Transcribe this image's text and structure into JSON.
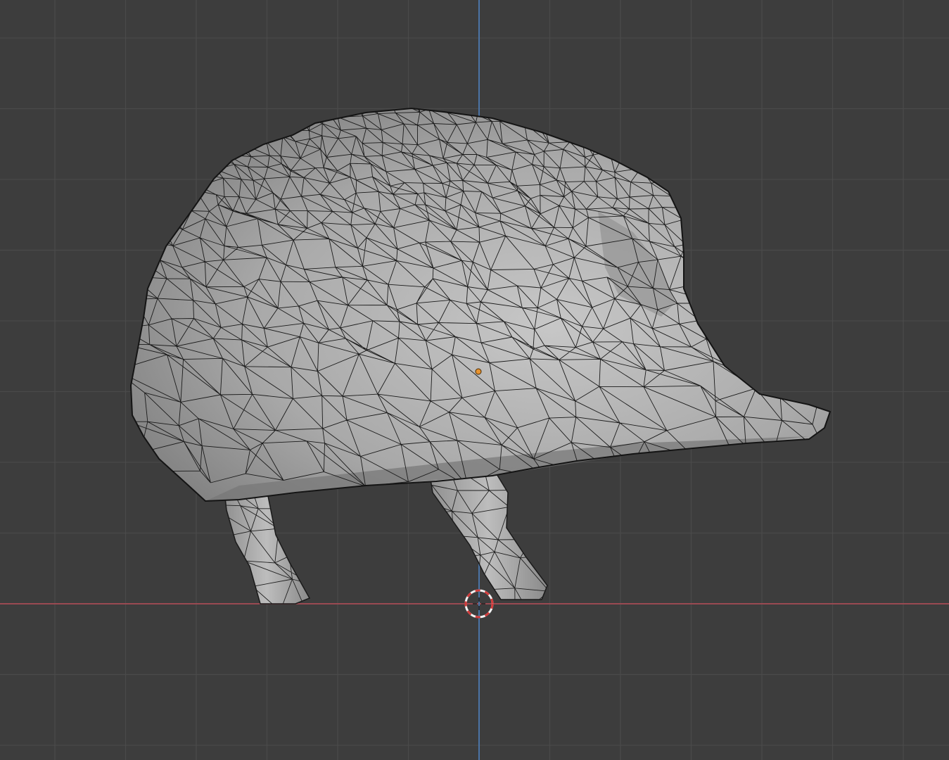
{
  "viewport": {
    "background": "#3d3d3d",
    "view": "front-orthographic",
    "grid_color": "#4a4a4a",
    "x_axis_color": "#9a4a52",
    "z_axis_color": "#4b74a6",
    "mesh": {
      "object": "hedgehog",
      "shading": "solid",
      "overlay": "wireframe",
      "surface_color": "#a9a9a9",
      "wire_color": "#1a1a1a",
      "origin_color": "#e8932f"
    },
    "cursor": {
      "icon": "3d-cursor-icon",
      "colors": [
        "#d23b3b",
        "#f2f2f2"
      ]
    }
  }
}
